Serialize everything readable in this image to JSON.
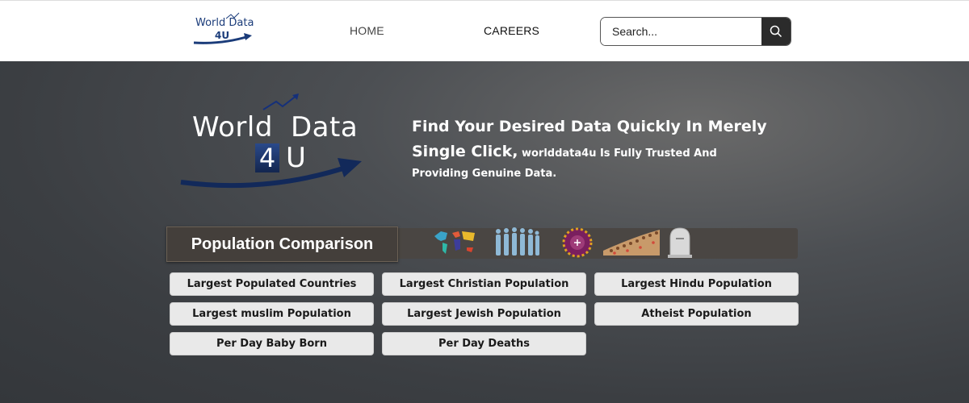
{
  "header": {
    "logo": {
      "line1": "World  Data",
      "line2": "4U"
    },
    "nav": [
      {
        "label": "HOME"
      },
      {
        "label": "CAREERS"
      }
    ],
    "search": {
      "placeholder": "Search...",
      "button_icon": "search-icon"
    }
  },
  "hero": {
    "logo": {
      "word1": "World",
      "word2": "Data",
      "digit": "4",
      "letter": "U"
    },
    "tagline": {
      "line1": "Find Your Desired Data Quickly In Merely",
      "line2_big": "Single Click,",
      "line2_small": " worlddata4u Is Fully Trusted And",
      "line3": "Providing Genuine Data."
    },
    "section_title": "Population Comparison",
    "icons": [
      "world-map-icon",
      "crowd-icon",
      "religion-symbols-icon",
      "population-crowd-icon",
      "tombstone-icon"
    ],
    "buttons": [
      {
        "label": "Largest Populated Countries"
      },
      {
        "label": "Largest Christian Population"
      },
      {
        "label": "Largest Hindu Population"
      },
      {
        "label": "Largest muslim Population"
      },
      {
        "label": "Largest Jewish Population"
      },
      {
        "label": "Atheist Population"
      },
      {
        "label": "Per Day Baby Born"
      },
      {
        "label": "Per Day Deaths"
      }
    ]
  },
  "colors": {
    "hero_dark": "#3b3e42",
    "logo_blue": "#1b3c7a",
    "button_bg": "#e9e9e9",
    "search_button": "#2b2b2b"
  }
}
